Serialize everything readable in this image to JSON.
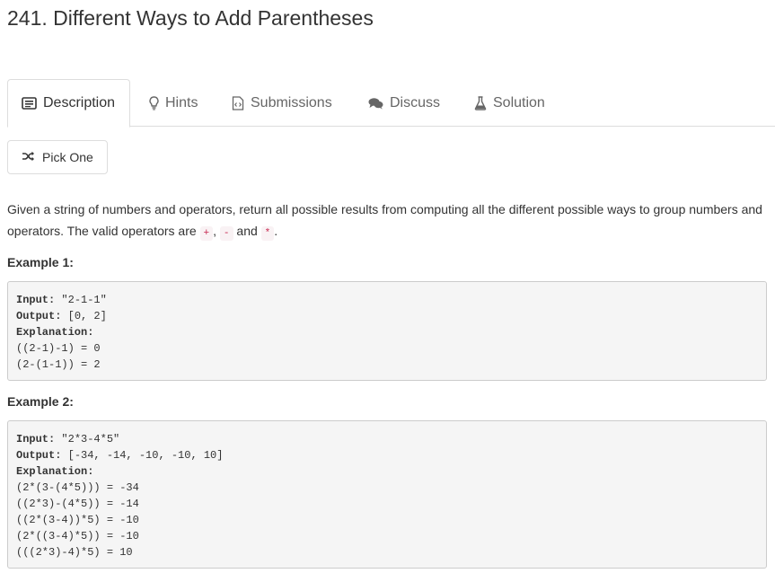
{
  "problem": {
    "title": "241. Different Ways to Add Parentheses"
  },
  "tabs": [
    {
      "label": "Description",
      "icon": "description-icon",
      "active": true
    },
    {
      "label": "Hints",
      "icon": "lightbulb-icon",
      "active": false
    },
    {
      "label": "Submissions",
      "icon": "code-file-icon",
      "active": false
    },
    {
      "label": "Discuss",
      "icon": "comments-icon",
      "active": false
    },
    {
      "label": "Solution",
      "icon": "flask-icon",
      "active": false
    }
  ],
  "pick_one": {
    "label": "Pick One",
    "icon": "shuffle-icon"
  },
  "description": {
    "text_1": "Given a string of numbers and operators, return all possible results from computing all the different possible ways to group numbers and operators. The valid operators are ",
    "op_plus": "+",
    "sep_1": ", ",
    "op_minus": "-",
    "sep_2": " and ",
    "op_times": "*",
    "text_end": "."
  },
  "examples": [
    {
      "heading": "Example 1:",
      "input_label": "Input:",
      "input_value": " \"2-1-1\"",
      "output_label": "Output:",
      "output_value": " [0, 2]",
      "explanation_label": "Explanation:",
      "lines": [
        "((2-1)-1) = 0",
        "(2-(1-1)) = 2"
      ]
    },
    {
      "heading": "Example 2:",
      "input_label": "Input:",
      "input_value": " \"2*3-4*5\"",
      "output_label": "Output:",
      "output_value": " [-34, -14, -10, -10, 10]",
      "explanation_label": "Explanation:",
      "lines": [
        "(2*(3-(4*5))) = -34",
        "((2*3)-(4*5)) = -14",
        "((2*(3-4))*5) = -10",
        "(2*((3-4)*5)) = -10",
        "(((2*3)-4)*5) = 10"
      ]
    }
  ],
  "colors": {
    "text": "#333333",
    "tab_text": "#666666",
    "border": "#dddddd",
    "code_bg": "#f5f5f5",
    "inline_code": "#c7254e"
  }
}
